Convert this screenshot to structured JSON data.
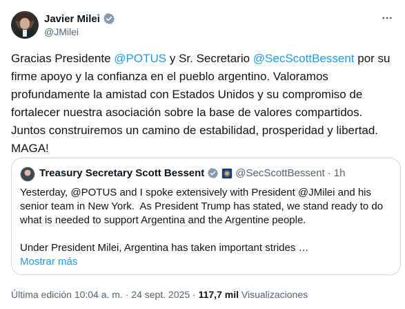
{
  "author": {
    "display_name": "Javier Milei",
    "handle": "@JMilei",
    "verified_icon": "verified-badge-icon"
  },
  "tweet": {
    "segments": [
      {
        "text": "Gracias Presidente ",
        "type": "text"
      },
      {
        "text": "@POTUS",
        "type": "mention"
      },
      {
        "text": " y Sr. Secretario ",
        "type": "text"
      },
      {
        "text": "@SecScottBessent",
        "type": "mention"
      },
      {
        "text": " por su firme apoyo y la confianza en el pueblo argentino. Valoramos profundamente la amistad con Estados Unidos y su compromiso de fortalecer nuestra asociación sobre la base de valores compartidos. Juntos construiremos un camino de estabilidad, prosperidad y libertad.\nMAGA!",
        "type": "text"
      }
    ]
  },
  "quoted": {
    "display_name": "Treasury Secretary Scott Bessent",
    "handle": "@SecScottBessent",
    "separator": "·",
    "time": "1h",
    "body": "Yesterday, @POTUS and I spoke extensively with President @JMilei and his senior team in New York.  As President Trump has stated, we stand ready to do what is needed to support Argentina and the Argentine people.\n\nUnder President Milei, Argentina has taken important strides …",
    "show_more": "Mostrar más"
  },
  "meta": {
    "edited_label": "Última edición 10:04 a. m. · 24 sept. 2025 · ",
    "views_count": "117,7 mil",
    "views_label": " Visualizaciones"
  },
  "colors": {
    "accent": "#1d9bf0",
    "secondary_text": "#536471",
    "border": "#cfd9de"
  }
}
